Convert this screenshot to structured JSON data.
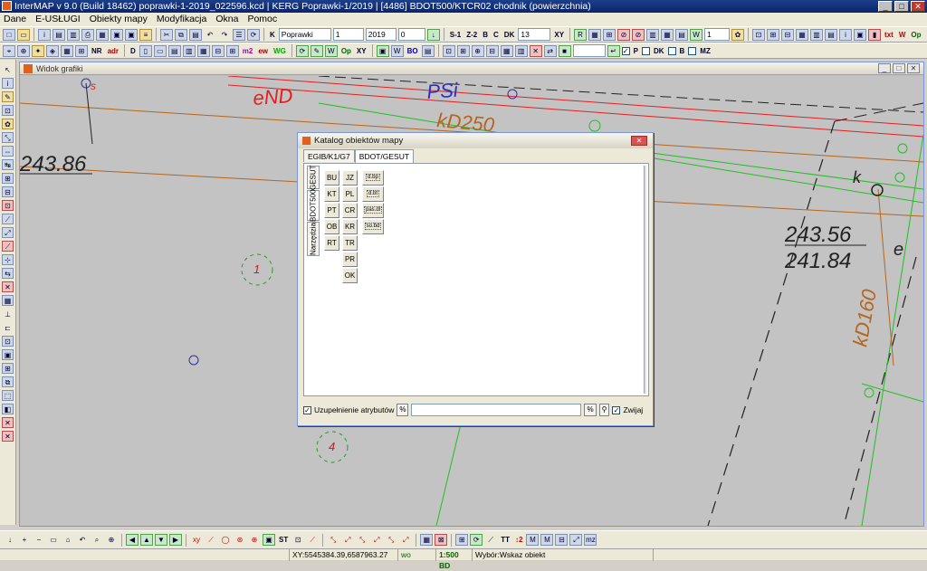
{
  "window": {
    "title": "InterMAP v 9.0 (Build 18462)   poprawki-1-2019_022596.kcd | KERG Poprawki-1/2019 | [4486] BDOT500/KTCR02 chodnik (powierzchnia)",
    "minimize": "_",
    "maximize": "□",
    "close": "✕"
  },
  "menu": [
    "Dane",
    "E-USŁUGI",
    "Obiekty mapy",
    "Modyfikacja",
    "Okna",
    "Pomoc"
  ],
  "toolbar1": {
    "kerg_value": "Poprawki",
    "number_value": "1",
    "year_value": "2019",
    "zero_value": "0",
    "s1_label": "S-1",
    "z2_label": "Z-2",
    "b_label": "B",
    "c_label": "C",
    "dk_label": "DK",
    "scale_value": "13",
    "xy_label": "XY",
    "txt_label": "txt",
    "w_label": "W",
    "op_label": "Op"
  },
  "toolbar2": {
    "nr_label": "NR",
    "adr_label": "adr",
    "d_label": "D",
    "m2_label": "m2",
    "ew_label": "ew",
    "wg_label": "WG",
    "op_label": "Op",
    "xy_label": "XY",
    "bo_label": "BO",
    "p_label": "P",
    "dk_label": "DK",
    "b_label": "B",
    "mz_label": "MZ"
  },
  "map_window": {
    "title": "Widok grafiki",
    "labels": {
      "end": "eND",
      "psi": "PSi",
      "kd250": "kD250",
      "h1": "243.86",
      "h2": "243.56",
      "h3": "241.84",
      "kd160": "kD160",
      "k": "k",
      "e": "e",
      "s": "s",
      "n1": "1",
      "n4": "4"
    }
  },
  "dialog": {
    "title": "Katalog obiektów mapy",
    "close": "✕",
    "tabs": [
      "EGIB/K1/G7",
      "BDOT/GESUT"
    ],
    "vertical_tabs": [
      "GESUT",
      "BDOT500",
      "Narzędzia"
    ],
    "col1": [
      "BU",
      "KT",
      "PT",
      "OB",
      "RT"
    ],
    "col2": [
      "JZ",
      "PL",
      "CR",
      "KR",
      "TR",
      "PR",
      "OK"
    ],
    "col3": [
      "d.bp",
      "d.bt",
      "pas.dl",
      "so.bd"
    ],
    "checkbox_label": "Uzupełnienie atrybutów",
    "percent_left": "%",
    "percent_right": "%",
    "binocular": "⚲",
    "collapse_label": "Zwijaj",
    "search_value": ""
  },
  "statusbar": {
    "coords": "XY:5545384.39,6587963.27",
    "wo": "wo",
    "scale": "1:500 BD",
    "status": "Wybór:Wskaz obiekt"
  }
}
